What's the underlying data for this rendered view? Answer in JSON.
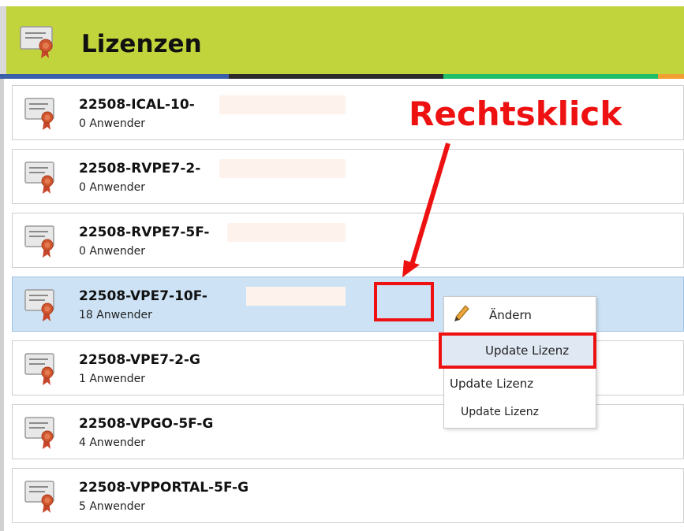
{
  "header": {
    "title": "Lizenzen",
    "bg_color": "#c2d43b"
  },
  "stripe_colors": [
    "#3a5fa8",
    "#2b2b2b",
    "#1fbf6a",
    "#f0a030"
  ],
  "licenses": [
    {
      "name": "22508-ICAL-10-",
      "users": "0 Anwender",
      "selected": false
    },
    {
      "name": "22508-RVPE7-2-",
      "users": "0 Anwender",
      "selected": false
    },
    {
      "name": "22508-RVPE7-5F-",
      "users": "0 Anwender",
      "selected": false
    },
    {
      "name": "22508-VPE7-10F-",
      "users": "18 Anwender",
      "selected": true
    },
    {
      "name": "22508-VPE7-2-G",
      "users": "1 Anwender",
      "selected": false
    },
    {
      "name": "22508-VPGO-5F-G",
      "users": "4 Anwender",
      "selected": false
    },
    {
      "name": "22508-VPPORTAL-5F-G",
      "users": "5 Anwender",
      "selected": false
    }
  ],
  "annotation": {
    "text": "Rechtsklick",
    "color": "#ee1111"
  },
  "context_menu": {
    "edit_label": "Ändern",
    "edit_icon": "pencil-icon",
    "update_label_1": "Update Lizenz",
    "update_label_2": "Update Lizenz",
    "update_label_3": "Update Lizenz"
  }
}
